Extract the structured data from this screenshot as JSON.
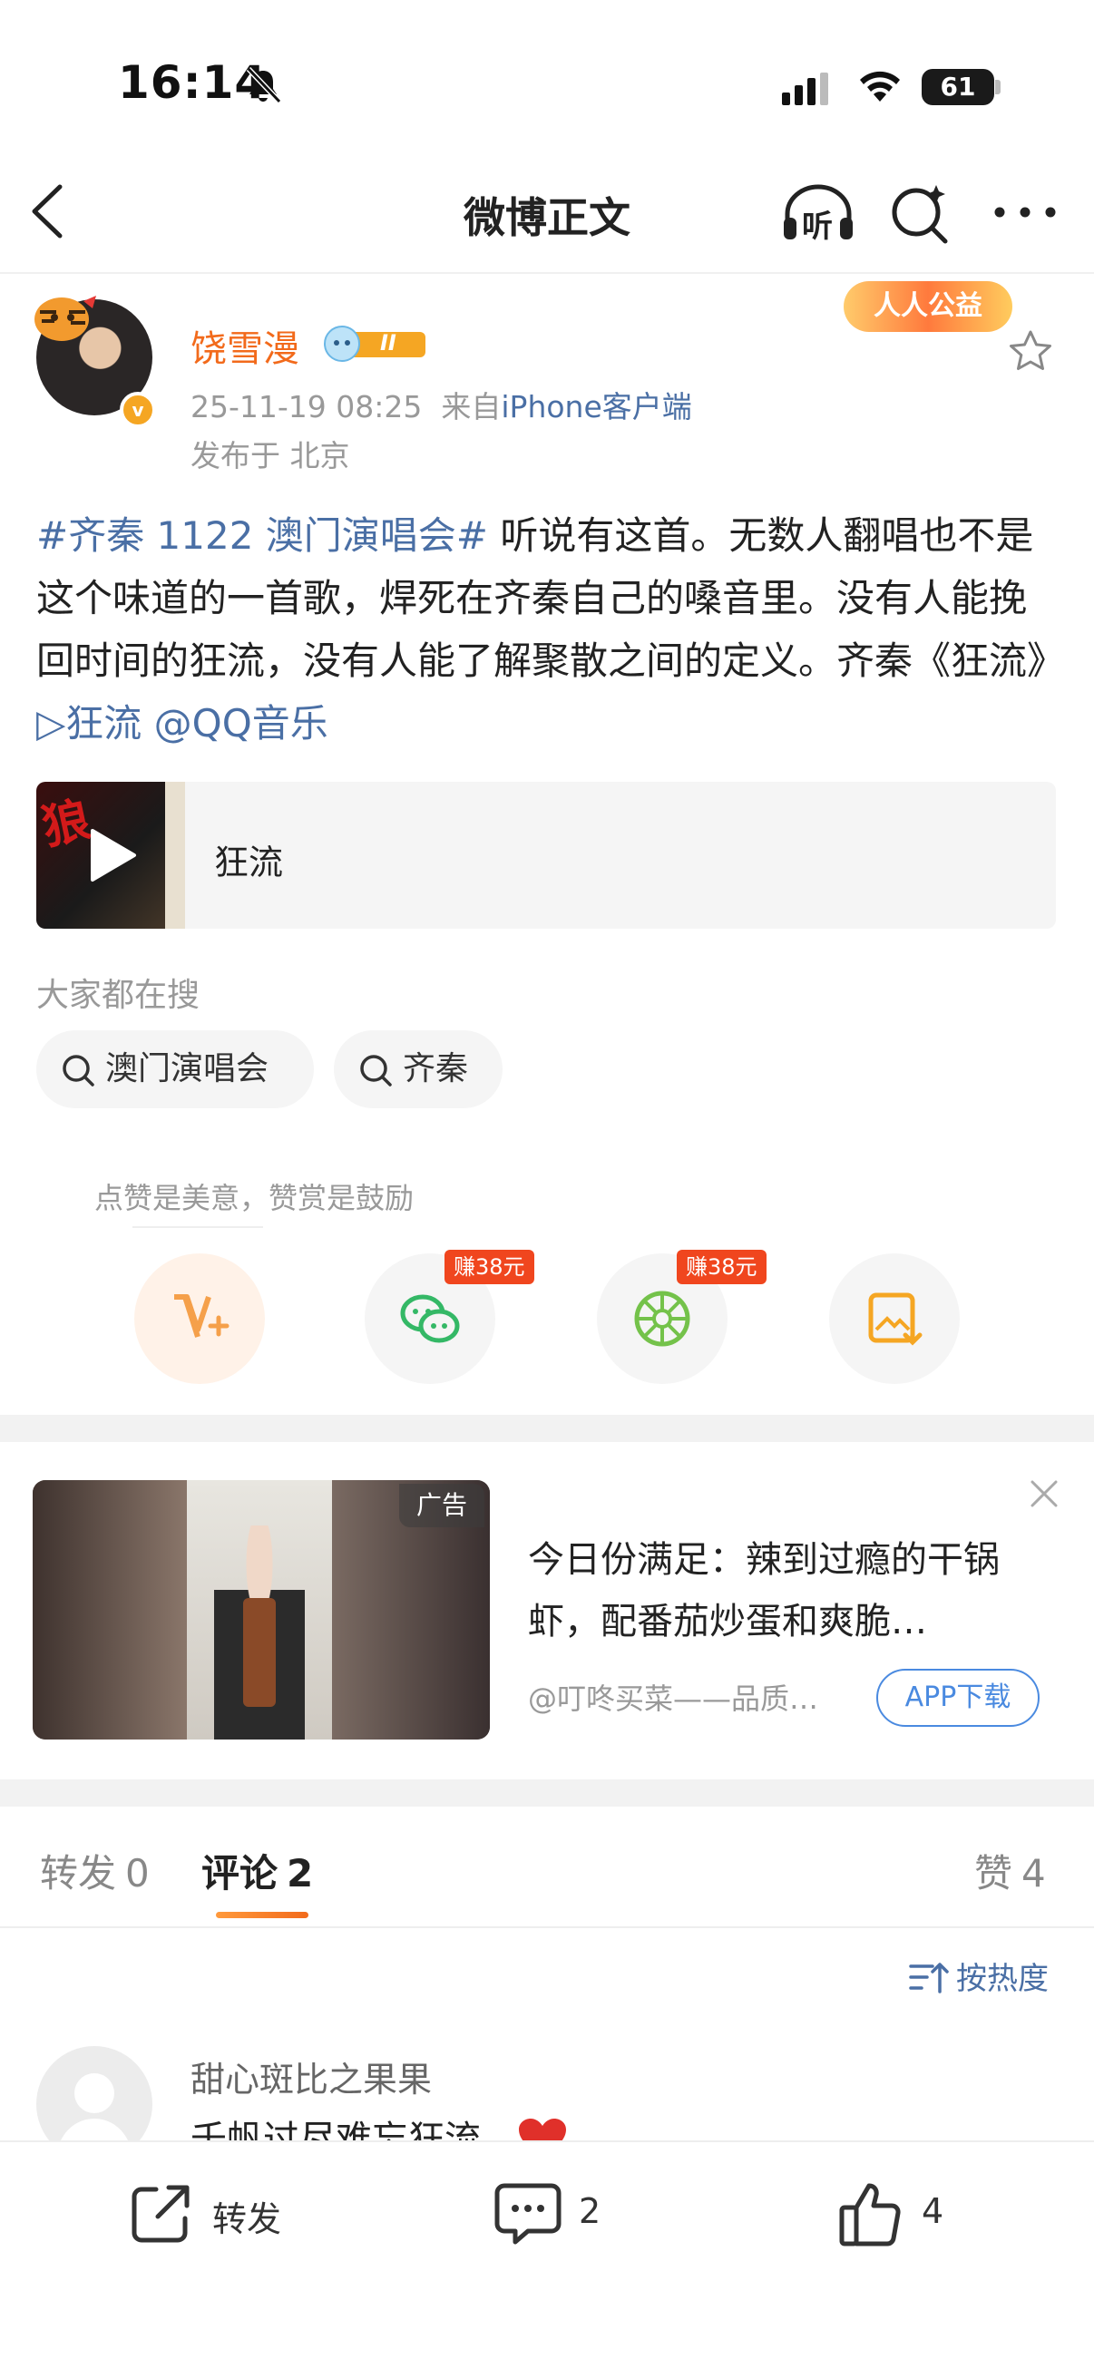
{
  "status_bar": {
    "time": "16:14",
    "battery": "61"
  },
  "nav": {
    "title": "微博正文",
    "listen_label": "听"
  },
  "post": {
    "username": "饶雪漫",
    "member_level": "II",
    "vip_initial": "v",
    "date": "25-11-19 08:25",
    "source_prefix": "来自",
    "source": "iPhone客户端",
    "location": "发布于 北京",
    "gongyi_badge": "人人公益",
    "text": {
      "hashtag": "#齐秦 1122 澳门演唱会#",
      "body": " 听说有这首。无数人翻唱也不是这个味道的一首歌，焊死在齐秦自己的嗓音里。没有人能挽回时间的狂流，没有人能了解聚散之间的定义。齐秦《狂流》",
      "music_link": "▷狂流",
      "mention": " @QQ音乐"
    },
    "music_card": {
      "title": "狂流",
      "cover_char": "狼"
    }
  },
  "search": {
    "header": "大家都在搜",
    "chips": [
      "澳门演唱会",
      "齐秦"
    ]
  },
  "reward": {
    "hint": "点赞是美意，赞赏是鼓励",
    "badges": [
      "赚38元",
      "赚38元"
    ]
  },
  "ad": {
    "tag": "广告",
    "text": "今日份满足：辣到过瘾的干锅虾，配番茄炒蛋和爽脆…",
    "source": "@叮咚买菜——品质…",
    "button": "APP下载"
  },
  "tabs": {
    "repost_label": "转发",
    "repost_count": "0",
    "comment_label": "评论",
    "comment_count": "2",
    "like_label": "赞",
    "like_count": "4"
  },
  "sort_label": "按热度",
  "comments": [
    {
      "name": "甜心斑比之果果",
      "text": "千帆过尽难忘狂流"
    }
  ],
  "bottom_bar": {
    "repost_label": "转发",
    "comment_count": "2",
    "like_count": "4"
  },
  "colors": {
    "accent_orange": "#f26a1b",
    "link_blue": "#4a6fa5",
    "earn_red": "#f0461e"
  }
}
